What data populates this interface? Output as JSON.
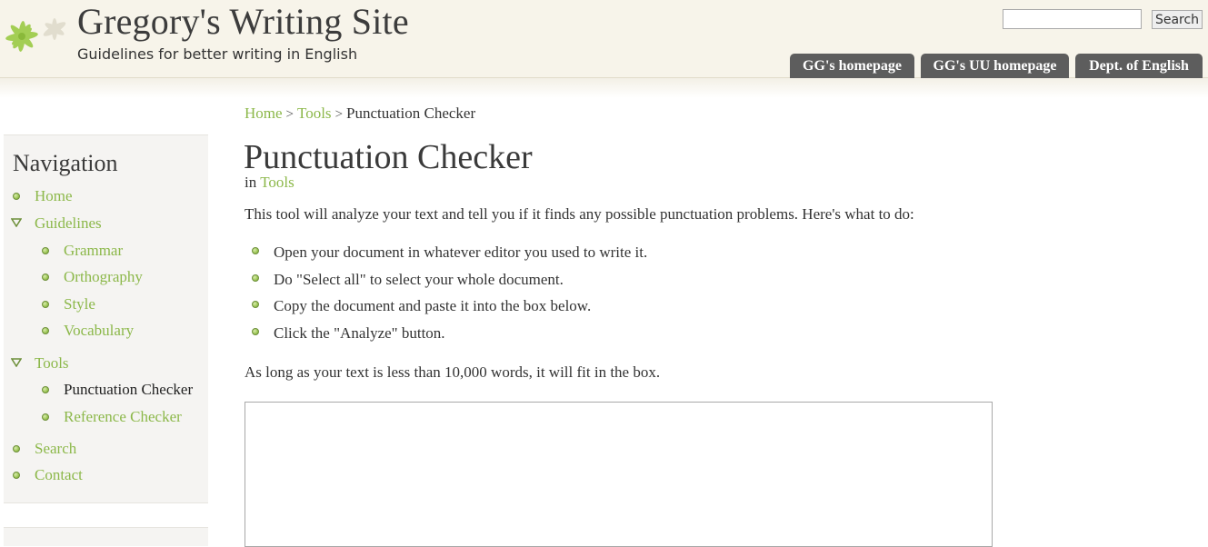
{
  "site": {
    "name": "Gregory's Writing Site",
    "slogan": "Guidelines for better writing in English"
  },
  "search": {
    "value": "",
    "button_label": "Search"
  },
  "header_tabs": [
    {
      "label": "GG's homepage"
    },
    {
      "label": "GG's UU homepage"
    },
    {
      "label": "Dept. of English"
    }
  ],
  "sidebar": {
    "title": "Navigation",
    "items": {
      "home": "Home",
      "guidelines": "Guidelines",
      "grammar": "Grammar",
      "orthography": "Orthography",
      "style": "Style",
      "vocabulary": "Vocabulary",
      "tools": "Tools",
      "punctuation_checker": "Punctuation Checker",
      "reference_checker": "Reference Checker",
      "search": "Search",
      "contact": "Contact"
    }
  },
  "breadcrumb": {
    "home": "Home",
    "sep": ">",
    "tools": "Tools",
    "current": "Punctuation Checker"
  },
  "page": {
    "title": "Punctuation Checker",
    "category_prefix": "in",
    "category": "Tools",
    "intro": "This tool will analyze your text and tell you if it finds any possible punctuation problems. Here's what to do:",
    "steps": [
      "Open your document in whatever editor you used to write it.",
      "Do \"Select all\" to select your whole document.",
      "Copy the document and paste it into the box below.",
      "Click the \"Analyze\" button."
    ],
    "limit_note": "As long as your text is less than 10,000 words, it will fit in the box.",
    "text_box_value": ""
  },
  "colors": {
    "link": "#8cb84a",
    "header_bg": "#f7f4ea",
    "tab_bg": "#5d5d5d",
    "sidebar_bg": "#f5f4f2"
  }
}
